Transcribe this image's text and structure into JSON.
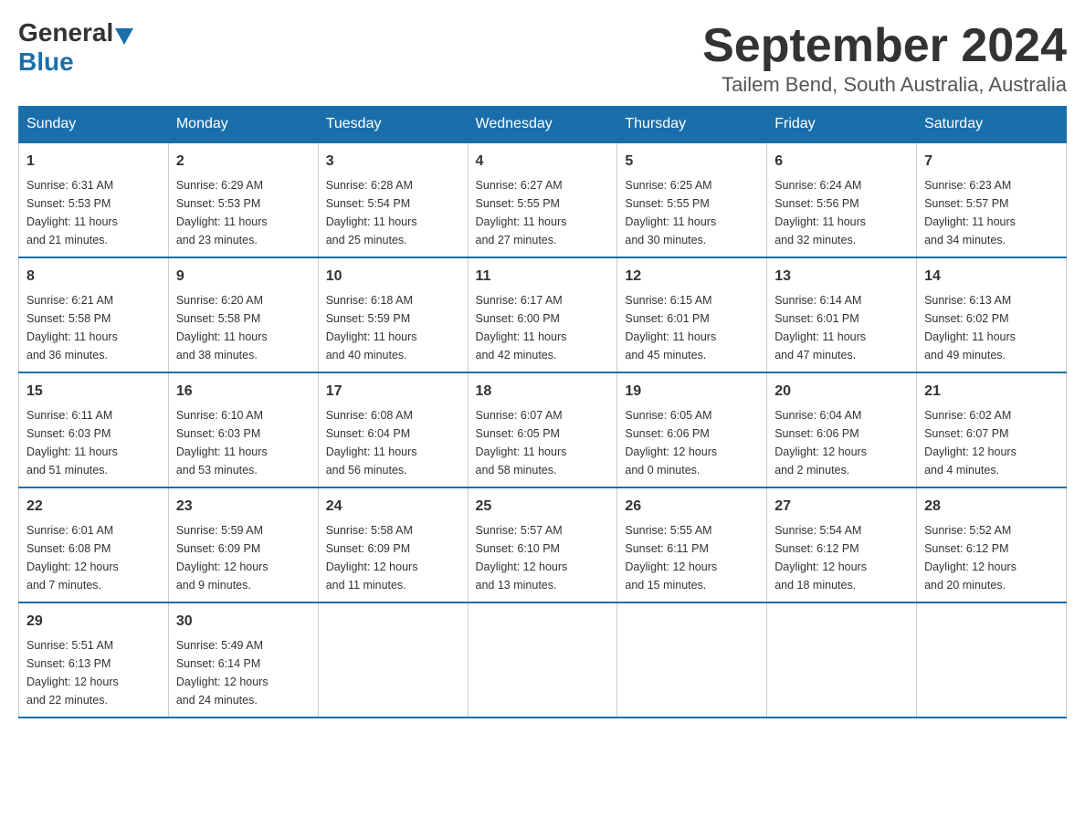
{
  "header": {
    "logo_text_general": "General",
    "logo_text_blue": "Blue",
    "month_title": "September 2024",
    "location": "Tailem Bend, South Australia, Australia"
  },
  "days_of_week": [
    "Sunday",
    "Monday",
    "Tuesday",
    "Wednesday",
    "Thursday",
    "Friday",
    "Saturday"
  ],
  "weeks": [
    [
      {
        "day": "1",
        "info": "Sunrise: 6:31 AM\nSunset: 5:53 PM\nDaylight: 11 hours\nand 21 minutes."
      },
      {
        "day": "2",
        "info": "Sunrise: 6:29 AM\nSunset: 5:53 PM\nDaylight: 11 hours\nand 23 minutes."
      },
      {
        "day": "3",
        "info": "Sunrise: 6:28 AM\nSunset: 5:54 PM\nDaylight: 11 hours\nand 25 minutes."
      },
      {
        "day": "4",
        "info": "Sunrise: 6:27 AM\nSunset: 5:55 PM\nDaylight: 11 hours\nand 27 minutes."
      },
      {
        "day": "5",
        "info": "Sunrise: 6:25 AM\nSunset: 5:55 PM\nDaylight: 11 hours\nand 30 minutes."
      },
      {
        "day": "6",
        "info": "Sunrise: 6:24 AM\nSunset: 5:56 PM\nDaylight: 11 hours\nand 32 minutes."
      },
      {
        "day": "7",
        "info": "Sunrise: 6:23 AM\nSunset: 5:57 PM\nDaylight: 11 hours\nand 34 minutes."
      }
    ],
    [
      {
        "day": "8",
        "info": "Sunrise: 6:21 AM\nSunset: 5:58 PM\nDaylight: 11 hours\nand 36 minutes."
      },
      {
        "day": "9",
        "info": "Sunrise: 6:20 AM\nSunset: 5:58 PM\nDaylight: 11 hours\nand 38 minutes."
      },
      {
        "day": "10",
        "info": "Sunrise: 6:18 AM\nSunset: 5:59 PM\nDaylight: 11 hours\nand 40 minutes."
      },
      {
        "day": "11",
        "info": "Sunrise: 6:17 AM\nSunset: 6:00 PM\nDaylight: 11 hours\nand 42 minutes."
      },
      {
        "day": "12",
        "info": "Sunrise: 6:15 AM\nSunset: 6:01 PM\nDaylight: 11 hours\nand 45 minutes."
      },
      {
        "day": "13",
        "info": "Sunrise: 6:14 AM\nSunset: 6:01 PM\nDaylight: 11 hours\nand 47 minutes."
      },
      {
        "day": "14",
        "info": "Sunrise: 6:13 AM\nSunset: 6:02 PM\nDaylight: 11 hours\nand 49 minutes."
      }
    ],
    [
      {
        "day": "15",
        "info": "Sunrise: 6:11 AM\nSunset: 6:03 PM\nDaylight: 11 hours\nand 51 minutes."
      },
      {
        "day": "16",
        "info": "Sunrise: 6:10 AM\nSunset: 6:03 PM\nDaylight: 11 hours\nand 53 minutes."
      },
      {
        "day": "17",
        "info": "Sunrise: 6:08 AM\nSunset: 6:04 PM\nDaylight: 11 hours\nand 56 minutes."
      },
      {
        "day": "18",
        "info": "Sunrise: 6:07 AM\nSunset: 6:05 PM\nDaylight: 11 hours\nand 58 minutes."
      },
      {
        "day": "19",
        "info": "Sunrise: 6:05 AM\nSunset: 6:06 PM\nDaylight: 12 hours\nand 0 minutes."
      },
      {
        "day": "20",
        "info": "Sunrise: 6:04 AM\nSunset: 6:06 PM\nDaylight: 12 hours\nand 2 minutes."
      },
      {
        "day": "21",
        "info": "Sunrise: 6:02 AM\nSunset: 6:07 PM\nDaylight: 12 hours\nand 4 minutes."
      }
    ],
    [
      {
        "day": "22",
        "info": "Sunrise: 6:01 AM\nSunset: 6:08 PM\nDaylight: 12 hours\nand 7 minutes."
      },
      {
        "day": "23",
        "info": "Sunrise: 5:59 AM\nSunset: 6:09 PM\nDaylight: 12 hours\nand 9 minutes."
      },
      {
        "day": "24",
        "info": "Sunrise: 5:58 AM\nSunset: 6:09 PM\nDaylight: 12 hours\nand 11 minutes."
      },
      {
        "day": "25",
        "info": "Sunrise: 5:57 AM\nSunset: 6:10 PM\nDaylight: 12 hours\nand 13 minutes."
      },
      {
        "day": "26",
        "info": "Sunrise: 5:55 AM\nSunset: 6:11 PM\nDaylight: 12 hours\nand 15 minutes."
      },
      {
        "day": "27",
        "info": "Sunrise: 5:54 AM\nSunset: 6:12 PM\nDaylight: 12 hours\nand 18 minutes."
      },
      {
        "day": "28",
        "info": "Sunrise: 5:52 AM\nSunset: 6:12 PM\nDaylight: 12 hours\nand 20 minutes."
      }
    ],
    [
      {
        "day": "29",
        "info": "Sunrise: 5:51 AM\nSunset: 6:13 PM\nDaylight: 12 hours\nand 22 minutes."
      },
      {
        "day": "30",
        "info": "Sunrise: 5:49 AM\nSunset: 6:14 PM\nDaylight: 12 hours\nand 24 minutes."
      },
      {
        "day": "",
        "info": ""
      },
      {
        "day": "",
        "info": ""
      },
      {
        "day": "",
        "info": ""
      },
      {
        "day": "",
        "info": ""
      },
      {
        "day": "",
        "info": ""
      }
    ]
  ]
}
